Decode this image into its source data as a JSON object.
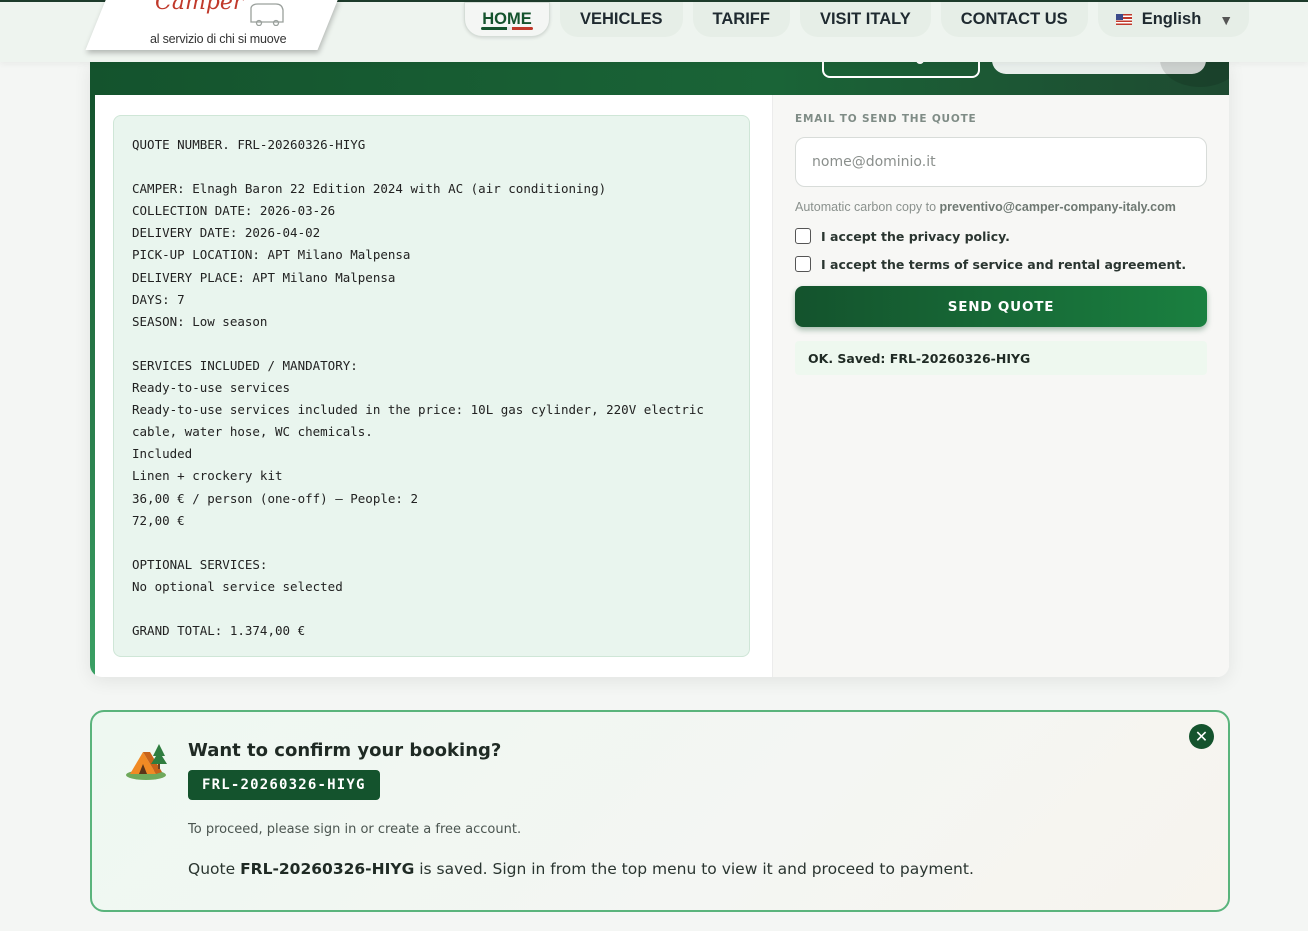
{
  "logo": {
    "script": "Camper",
    "tagline": "al servizio di chi si muove"
  },
  "nav": {
    "items": [
      "HOME",
      "VEHICLES",
      "TARIFF",
      "VISIT ITALY",
      "CONTACT US"
    ],
    "language": "English",
    "active": "HOME"
  },
  "quote": {
    "text": "QUOTE NUMBER. FRL-20260326-HIYG\n\nCAMPER: Elnagh Baron 22 Edition 2024 with AC (air conditioning)\nCOLLECTION DATE: 2026-03-26\nDELIVERY DATE: 2026-04-02\nPICK-UP LOCATION: APT Milano Malpensa\nDELIVERY PLACE: APT Milano Malpensa\nDAYS: 7\nSEASON: Low season\n\nSERVICES INCLUDED / MANDATORY:\nReady-to-use services\nReady-to-use services included in the price: 10L gas cylinder, 220V electric\ncable, water hose, WC chemicals.\nIncluded\nLinen + crockery kit\n36,00 € / person (one-off) — People: 2\n72,00 €\n\nOPTIONAL SERVICES:\nNo optional service selected\n\nGRAND TOTAL: 1.374,00 €"
  },
  "form": {
    "email_label": "EMAIL TO SEND THE QUOTE",
    "email_placeholder": "nome@dominio.it",
    "email_value": "",
    "cc_prefix": "Automatic carbon copy to",
    "cc_email": "preventivo@camper-company-italy.com",
    "privacy_label": "I accept the privacy policy.",
    "terms_label": "I accept the terms of service and rental agreement.",
    "privacy_checked": false,
    "terms_checked": false,
    "send_label": "SEND QUOTE",
    "saved_message": "OK. Saved: FRL-20260326-HIYG"
  },
  "banner": {
    "title": "Want to confirm your booking?",
    "code": "FRL-20260326-HIYG",
    "proceed_text": "To proceed, please sign in or create a free account.",
    "saved_prefix": "Quote",
    "saved_code": "FRL-20260326-HIYG",
    "saved_suffix": "is saved. Sign in from the top menu to view it and proceed to payment.",
    "close_symbol": "✕"
  },
  "colors": {
    "brand_green": "#14532d",
    "accent_red": "#c0392b",
    "banner_border": "#5ab47c"
  },
  "icons": [
    "flag-us-icon",
    "chevron-down-icon",
    "tent-icon",
    "close-icon"
  ]
}
